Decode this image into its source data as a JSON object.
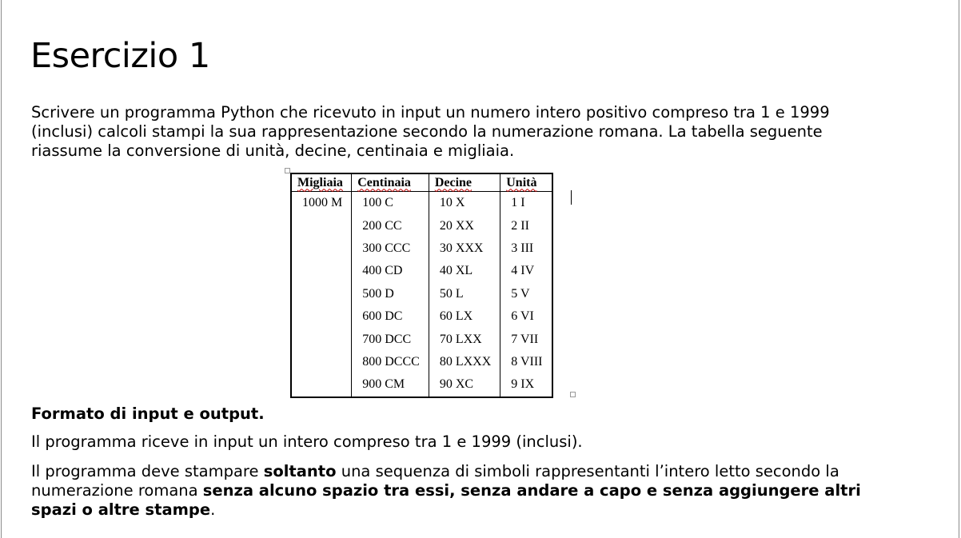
{
  "title": "Esercizio 1",
  "intro": "Scrivere un programma Python che ricevuto in input un numero intero positivo compreso tra 1 e 1999 (inclusi) calcoli stampi la sua rappresentazione secondo la numerazione romana. La tabella seguente riassume la conversione di unità, decine, centinaia e migliaia.",
  "table": {
    "headers": [
      "Migliaia",
      "Centinaia",
      "Decine",
      "Unità"
    ],
    "rows": [
      [
        "1000 M",
        "100 C",
        "10 X",
        "1 I"
      ],
      [
        "",
        "200 CC",
        "20 XX",
        "2 II"
      ],
      [
        "",
        "300 CCC",
        "30 XXX",
        "3 III"
      ],
      [
        "",
        "400 CD",
        "40 XL",
        "4 IV"
      ],
      [
        "",
        "500 D",
        "50 L",
        "5 V"
      ],
      [
        "",
        "600 DC",
        "60 LX",
        "6 VI"
      ],
      [
        "",
        "700 DCC",
        "70 LXX",
        "7 VII"
      ],
      [
        "",
        "800 DCCC",
        "80 LXXX",
        "8 VIII"
      ],
      [
        "",
        "900 CM",
        "90 XC",
        "9 IX"
      ]
    ]
  },
  "format_heading": "Formato di input e output.",
  "paragraph1": "Il programma riceve in input un intero compreso tra 1 e 1999 (inclusi).",
  "paragraph2": {
    "part1": "Il programma deve stampare ",
    "bold1": "soltanto",
    "part2": " una sequenza di simboli rappresentanti l’intero letto secondo la numerazione romana ",
    "bold2": "senza alcuno spazio tra essi, senza andare a capo e senza aggiungere altri spazi o altre stampe",
    "part3": "."
  }
}
